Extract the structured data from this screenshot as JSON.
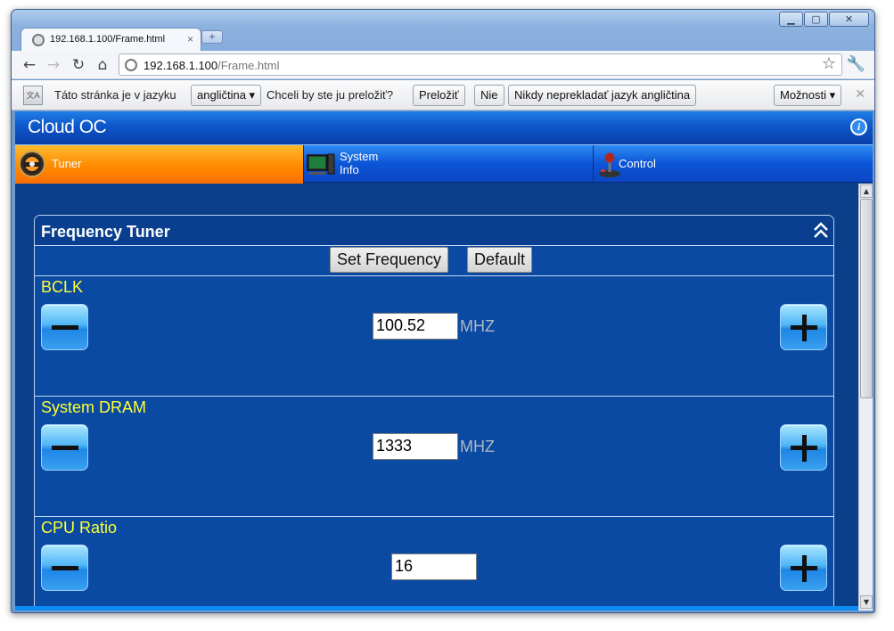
{
  "browser": {
    "tab_title": "192.168.1.100/Frame.html",
    "tab_close": "×",
    "new_tab": "+",
    "url_host": "192.168.1.100",
    "url_path": "/Frame.html",
    "window_controls": {
      "minimize": "▁",
      "maximize": "▢",
      "close": "✕"
    }
  },
  "translate_bar": {
    "icon_text": "文A",
    "prefix": "Táto stránka je v jazyku",
    "language": "angličtina ▾",
    "question": "Chceli by ste ju preložiť?",
    "translate_label": "Preložiť",
    "no_label": "Nie",
    "never_label": "Nikdy neprekladať jazyk angličtina",
    "options_label": "Možnosti ▾",
    "close": "✕"
  },
  "app": {
    "logo": "Cloud OC",
    "info": "i"
  },
  "nav": {
    "tuner": "Tuner",
    "system_info_line1": "System",
    "system_info_line2": "Info",
    "control": "Control"
  },
  "panel": {
    "title": "Frequency Tuner",
    "set_frequency": "Set Frequency",
    "default": "Default",
    "rows": [
      {
        "label": "BCLK",
        "value": "100.52",
        "unit": "MHZ"
      },
      {
        "label": "System DRAM",
        "value": "1333",
        "unit": "MHZ"
      },
      {
        "label": "CPU Ratio",
        "value": "16",
        "unit": ""
      }
    ]
  },
  "colors": {
    "page_bg": "#0c3f8a",
    "panel_bg": "#0a4aa3",
    "active_tab": "#ff8a00",
    "label_yellow": "#ffff33"
  }
}
